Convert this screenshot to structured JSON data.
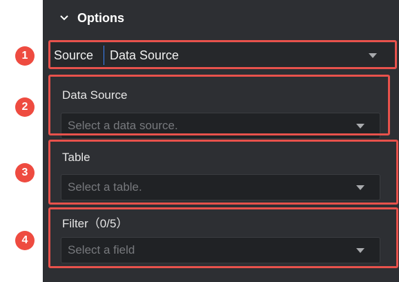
{
  "options": {
    "title": "Options"
  },
  "badges": [
    "1",
    "2",
    "3",
    "4"
  ],
  "source": {
    "label": "Source",
    "value": "Data Source"
  },
  "data_source": {
    "label": "Data Source",
    "placeholder": "Select a data source."
  },
  "table": {
    "label": "Table",
    "placeholder": "Select a table."
  },
  "filter": {
    "label": "Filter（0/5）",
    "placeholder": "Select a field"
  },
  "colors": {
    "panel": "#2d2f33",
    "highlight": "#e8524c",
    "badge": "#ee4b40",
    "accent": "#3b82f6"
  },
  "icons": {
    "header": "chevron-down-icon",
    "dropdown": "caret-down-icon"
  }
}
